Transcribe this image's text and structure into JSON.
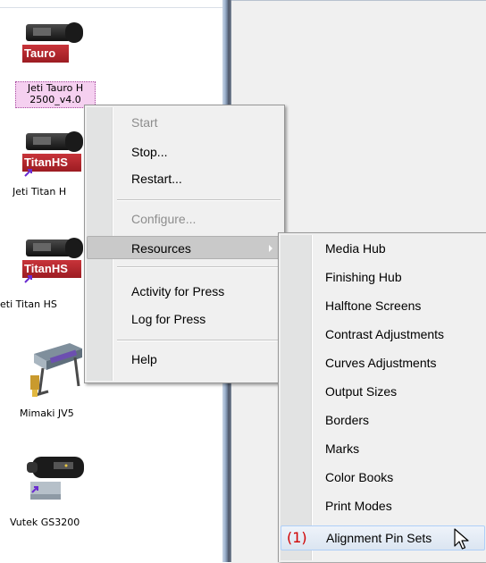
{
  "devices": [
    {
      "brand": "Tauro",
      "label_line1": "Jeti Tauro H",
      "label_line2": "2500_v4.0"
    },
    {
      "brand": "TitanHS",
      "label": "Jeti Titan H"
    },
    {
      "brand": "TitanHS",
      "label": "eti Titan HS"
    },
    {
      "label": "Mimaki JV5"
    },
    {
      "label": "Vutek GS3200"
    }
  ],
  "context_menu": {
    "items": [
      "Start",
      "Stop...",
      "Restart...",
      "Configure...",
      "Resources",
      "Activity for Press",
      "Log for Press",
      "Help"
    ]
  },
  "resources_submenu": {
    "items": [
      "Media Hub",
      "Finishing Hub",
      "Halftone Screens",
      "Contrast Adjustments",
      "Curves Adjustments",
      "Output Sizes",
      "Borders",
      "Marks",
      "Color Books",
      "Print Modes",
      "Alignment Pin Sets"
    ],
    "step_marker": "(1)"
  },
  "colors": {
    "brand_red": "#b0262c",
    "step_marker": "#d00000",
    "selection_pink": "#f5d0f0"
  }
}
